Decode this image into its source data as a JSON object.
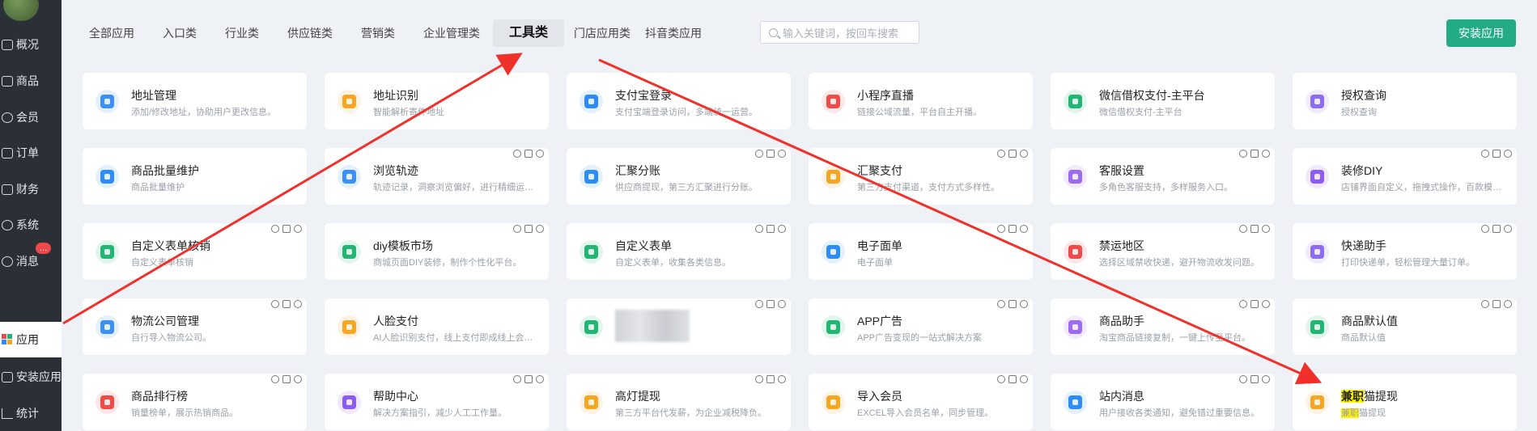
{
  "sidebar": {
    "items": [
      {
        "label": "概况",
        "icon": "chart-icon"
      },
      {
        "label": "商品",
        "icon": "goods-icon"
      },
      {
        "label": "会员",
        "icon": "users-icon"
      },
      {
        "label": "订单",
        "icon": "cart-icon"
      },
      {
        "label": "财务",
        "icon": "wallet-icon"
      },
      {
        "label": "系统",
        "icon": "gear-icon"
      },
      {
        "label": "消息",
        "icon": "message-icon"
      },
      {
        "label": "应用",
        "icon": "apps-icon"
      },
      {
        "label": "安装应用",
        "icon": "install-icon"
      },
      {
        "label": "统计",
        "icon": "stats-icon"
      }
    ],
    "message_badge": "...",
    "active_index": 7
  },
  "tabs": [
    "全部应用",
    "入口类",
    "行业类",
    "供应链类",
    "营销类",
    "企业管理类",
    "工具类",
    "门店应用类",
    "抖音类应用"
  ],
  "active_tab": "工具类",
  "search": {
    "placeholder": "输入关键词，按回车搜索"
  },
  "install_button": "安装应用",
  "cards": [
    {
      "title": "地址管理",
      "desc": "添加/修改地址，协助用户更改信息。",
      "color": "#3b8ff5"
    },
    {
      "title": "地址识别",
      "desc": "智能解析寄件地址",
      "color": "#f5a623"
    },
    {
      "title": "支付宝登录",
      "desc": "支付宝端登录访问，多端统一运营。",
      "color": "#2f8cf6"
    },
    {
      "title": "小程序直播",
      "desc": "链接公域流量，平台自主开播。",
      "color": "#f04b4b"
    },
    {
      "title": "微信借权支付-主平台",
      "desc": "微信借权支付-主平台",
      "color": "#22b573"
    },
    {
      "title": "授权查询",
      "desc": "授权查询",
      "color": "#8c6cf0"
    },
    {
      "title": "商品批量维护",
      "desc": "商品批量维护",
      "color": "#2f8cf6"
    },
    {
      "title": "浏览轨迹",
      "desc": "轨迹记录，洞察浏览偏好，进行精细运营。",
      "color": "#3b8ff5"
    },
    {
      "title": "汇聚分账",
      "desc": "供应商提现，第三方汇聚进行分账。",
      "color": "#2f8cf6"
    },
    {
      "title": "汇聚支付",
      "desc": "第三方支付渠道，支付方式多样性。",
      "color": "#f5a623"
    },
    {
      "title": "客服设置",
      "desc": "多角色客服支持，多样服务入口。",
      "color": "#9b6cf0"
    },
    {
      "title": "装修DIY",
      "desc": "店铺界面自定义，拖拽式操作，百款模版…",
      "color": "#8c5cf0"
    },
    {
      "title": "自定义表单核销",
      "desc": "自定义表单核销",
      "color": "#22b573"
    },
    {
      "title": "diy模板市场",
      "desc": "商城页面DIY装修，制作个性化平台。",
      "color": "#22b573"
    },
    {
      "title": "自定义表单",
      "desc": "自定义表单，收集各类信息。",
      "color": "#22b573"
    },
    {
      "title": "电子面单",
      "desc": "电子面单",
      "color": "#2f8cf6"
    },
    {
      "title": "禁运地区",
      "desc": "选择区域禁收快递，避开物流收发问题。",
      "color": "#f04b4b"
    },
    {
      "title": "快递助手",
      "desc": "打印快递单，轻松管理大量订单。",
      "color": "#8c6cf0"
    },
    {
      "title": "物流公司管理",
      "desc": "自行导入物流公司。",
      "color": "#3b8ff5"
    },
    {
      "title": "人脸支付",
      "desc": "AI人脸识别支付，线上支付即成线上会员。",
      "color": "#f5a623"
    },
    {
      "title": "",
      "desc": "",
      "color": "#22b573"
    },
    {
      "title": "APP广告",
      "desc": "APP广告变现的一站式解决方案",
      "color": "#22b573"
    },
    {
      "title": "商品助手",
      "desc": "淘宝商品链接复制，一键上传至平台。",
      "color": "#9b6cf0"
    },
    {
      "title": "商品默认值",
      "desc": "商品默认值",
      "color": "#22b573"
    },
    {
      "title": "商品排行榜",
      "desc": "销量榜单，展示热销商品。",
      "color": "#f04b4b"
    },
    {
      "title": "帮助中心",
      "desc": "解决方案指引，减少人工工作量。",
      "color": "#8c5cf0"
    },
    {
      "title": "高灯提现",
      "desc": "第三方平台代发薪，为企业减税降负。",
      "color": "#f5a623"
    },
    {
      "title": "导入会员",
      "desc": "EXCEL导入会员名单，同步管理。",
      "color": "#f5a623"
    },
    {
      "title": "站内消息",
      "desc": "用户接收各类通知，避免错过重要信息。",
      "color": "#2f8cf6"
    },
    {
      "title_hl": "兼职",
      "title_rest": "猫提现",
      "desc_hl": "兼职",
      "desc_rest": "猫提现",
      "color": "#f5a623"
    }
  ]
}
